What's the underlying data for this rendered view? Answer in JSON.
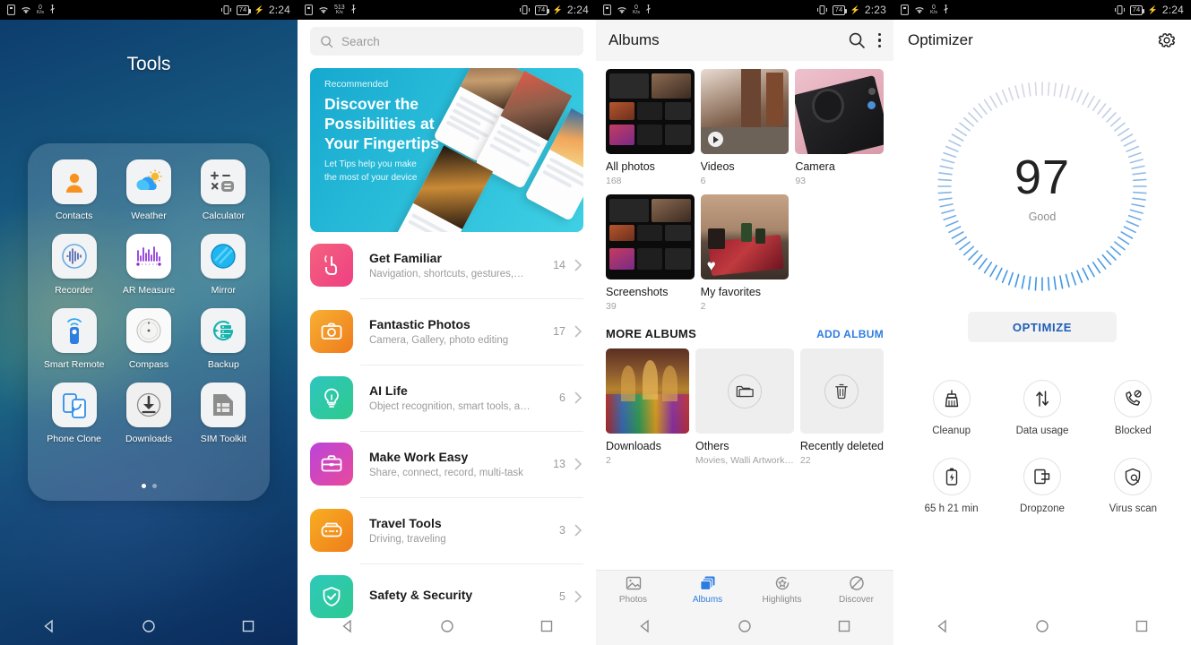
{
  "statusbars": [
    {
      "netspeed": "0",
      "unit": "K/s",
      "battery": "74",
      "time": "2:24"
    },
    {
      "netspeed": "513",
      "unit": "K/s",
      "battery": "74",
      "time": "2:24"
    },
    {
      "netspeed": "0",
      "unit": "K/s",
      "battery": "74",
      "time": "2:23"
    },
    {
      "netspeed": "0",
      "unit": "K/s",
      "battery": "74",
      "time": "2:24"
    }
  ],
  "folder": {
    "title": "Tools",
    "apps": [
      {
        "label": "Contacts",
        "icon": "contacts-icon"
      },
      {
        "label": "Weather",
        "icon": "weather-icon"
      },
      {
        "label": "Calculator",
        "icon": "calculator-icon"
      },
      {
        "label": "Recorder",
        "icon": "recorder-icon"
      },
      {
        "label": "AR Measure",
        "icon": "ar-measure-icon"
      },
      {
        "label": "Mirror",
        "icon": "mirror-icon"
      },
      {
        "label": "Smart Remote",
        "icon": "smart-remote-icon"
      },
      {
        "label": "Compass",
        "icon": "compass-icon"
      },
      {
        "label": "Backup",
        "icon": "backup-icon"
      },
      {
        "label": "Phone Clone",
        "icon": "phone-clone-icon"
      },
      {
        "label": "Downloads",
        "icon": "downloads-icon"
      },
      {
        "label": "SIM Toolkit",
        "icon": "sim-toolkit-icon"
      }
    ],
    "page_count": 2,
    "active_page": 1
  },
  "tips": {
    "search_placeholder": "Search",
    "banner": {
      "tag": "Recommended",
      "headline": "Discover the Possibilities at Your Fingertips",
      "subtext": "Let Tips help you make the most of your device",
      "bg_color": "#29bcd9"
    },
    "categories": [
      {
        "title": "Get Familiar",
        "subtitle": "Navigation, shortcuts, gestures,…",
        "count": "14",
        "icon": "tap-gesture-icon",
        "color_a": "#f4627d",
        "color_b": "#f0457f"
      },
      {
        "title": "Fantastic Photos",
        "subtitle": "Camera, Gallery, photo editing",
        "count": "17",
        "icon": "camera-icon",
        "color_a": "#f5a623",
        "color_b": "#f07c1e"
      },
      {
        "title": "AI Life",
        "subtitle": "Object recognition, smart tools, a…",
        "count": "6",
        "icon": "bulb-icon",
        "color_a": "#2fc2b6",
        "color_b": "#2ec98c"
      },
      {
        "title": "Make Work Easy",
        "subtitle": "Share, connect, record, multi-task",
        "count": "13",
        "icon": "briefcase-icon",
        "color_a": "#c044d8",
        "color_b": "#e5479a"
      },
      {
        "title": "Travel Tools",
        "subtitle": "Driving, traveling",
        "count": "3",
        "icon": "car-icon",
        "color_a": "#f6a81f",
        "color_b": "#f07d1c"
      },
      {
        "title": "Safety & Security",
        "subtitle": "",
        "count": "5",
        "icon": "shield-check-icon",
        "color_a": "#2fc9b9",
        "color_b": "#2ec98f"
      }
    ]
  },
  "gallery": {
    "title": "Albums",
    "search_icon": "search-icon",
    "menu_icon": "overflow-menu-icon",
    "albums": [
      {
        "name": "All photos",
        "count": "168",
        "thumb": "screenshot-dark"
      },
      {
        "name": "Videos",
        "count": "6",
        "thumb": "street-video",
        "badge": "play"
      },
      {
        "name": "Camera",
        "count": "93",
        "thumb": "phone-pink"
      },
      {
        "name": "Screenshots",
        "count": "39",
        "thumb": "screenshot-dark"
      },
      {
        "name": "My favorites",
        "count": "2",
        "thumb": "carpet-plants",
        "badge": "heart"
      }
    ],
    "more_albums_label": "MORE ALBUMS",
    "add_album_label": "ADD ALBUM",
    "more_albums": [
      {
        "name": "Downloads",
        "count": "2",
        "thumb": "mosque"
      },
      {
        "name": "Others",
        "count": "Movies, Walli Artwork…",
        "thumb": "folder-icon"
      },
      {
        "name": "Recently deleted",
        "count": "22",
        "thumb": "trash-icon"
      }
    ],
    "tabs": [
      {
        "label": "Photos",
        "icon": "photos-icon",
        "active": false
      },
      {
        "label": "Albums",
        "icon": "albums-icon",
        "active": true
      },
      {
        "label": "Highlights",
        "icon": "highlights-icon",
        "active": false
      },
      {
        "label": "Discover",
        "icon": "discover-icon",
        "active": false
      }
    ],
    "accent_color": "#2f7ce0"
  },
  "optimizer": {
    "title": "Optimizer",
    "settings_icon": "gear-icon",
    "score": "97",
    "score_label": "Good",
    "optimize_label": "OPTIMIZE",
    "optimize_color": "#1d5fb5",
    "tiles": [
      {
        "label": "Cleanup",
        "icon": "broom-icon"
      },
      {
        "label": "Data usage",
        "icon": "data-usage-icon"
      },
      {
        "label": "Blocked",
        "icon": "blocked-call-icon"
      },
      {
        "label": "65 h 21 min",
        "icon": "battery-icon"
      },
      {
        "label": "Dropzone",
        "icon": "dropzone-icon"
      },
      {
        "label": "Virus scan",
        "icon": "virus-scan-icon"
      }
    ]
  },
  "navbar": {
    "back": "back-icon",
    "home": "home-icon",
    "recents": "recents-icon"
  }
}
